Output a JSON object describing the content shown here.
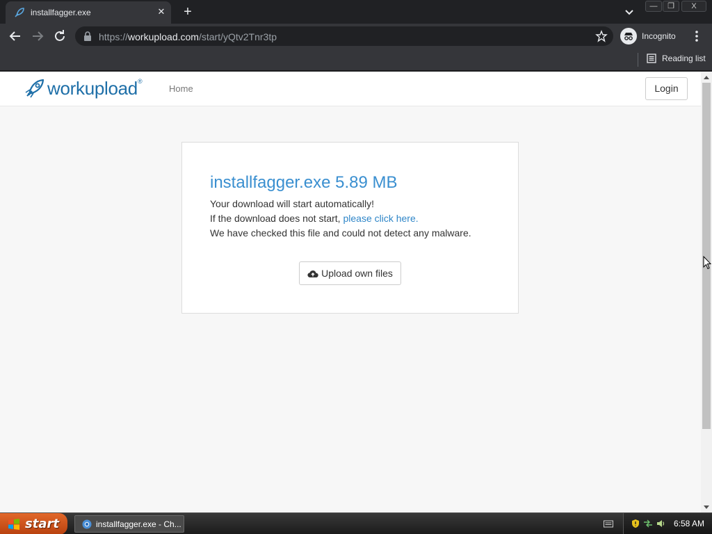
{
  "browser": {
    "tab": {
      "title": "installfagger.exe",
      "close": "✕"
    },
    "new_tab": "+",
    "window_controls": {
      "minimize": "—",
      "restore": "❐",
      "close": "X"
    },
    "address": {
      "scheme": "https://",
      "host": "workupload.com",
      "path": "/start/yQtv2Tnr3tp"
    },
    "profile_label": "Incognito",
    "reading_list_label": "Reading list"
  },
  "site": {
    "logo_text": "workupload",
    "logo_mark": "®",
    "nav_home": "Home",
    "login_label": "Login"
  },
  "download_panel": {
    "file_title": "installfagger.exe 5.89 MB",
    "line1": "Your download will start automatically!",
    "line2_prefix": "If the download does not start, ",
    "line2_link": "please click here.",
    "line3": "We have checked this file and could not detect any malware.",
    "upload_button": "Upload own files"
  },
  "taskbar": {
    "start_label": "start",
    "task_label": "installfagger.exe - Ch...",
    "clock": "6:58 AM"
  },
  "colors": {
    "accent": "#3a8fd0",
    "brand": "#1e6fa8",
    "start_button": "#d3551d"
  }
}
